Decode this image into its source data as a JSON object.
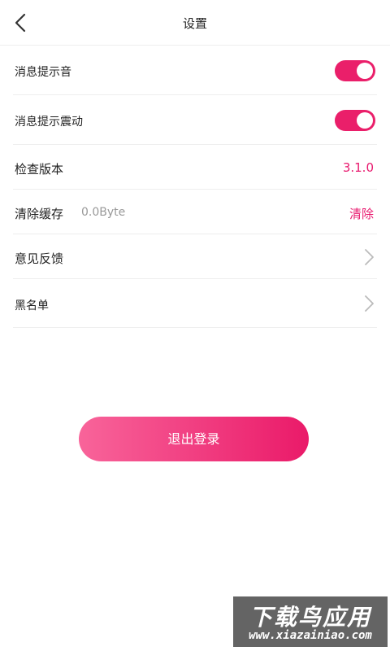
{
  "header": {
    "title": "设置",
    "back_icon": "chevron-left-icon"
  },
  "settings": {
    "notify_sound": {
      "label": "消息提示音",
      "enabled": true
    },
    "notify_vibrate": {
      "label": "消息提示震动",
      "enabled": true
    },
    "check_version": {
      "label": "检查版本",
      "value": "3.1.0"
    },
    "clear_cache": {
      "label": "清除缓存",
      "size": "0.0Byte",
      "action": "清除"
    },
    "feedback": {
      "label": "意见反馈"
    },
    "blacklist": {
      "label": "黑名单"
    }
  },
  "logout_button": {
    "label": "退出登录"
  },
  "watermark": {
    "top": "下载鸟应用",
    "bottom": "www.xiazainiao.com"
  },
  "colors": {
    "accent": "#ea1f6a",
    "gradient_start": "#f8649a",
    "gradient_end": "#ea1a69"
  }
}
